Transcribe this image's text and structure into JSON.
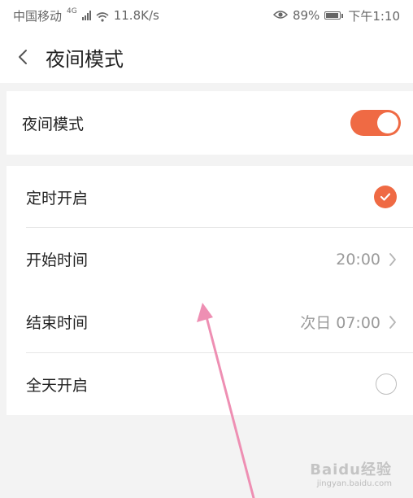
{
  "status_bar": {
    "carrier": "中国移动",
    "network_badge": "4G",
    "speed": "11.8K/s",
    "battery": "89%",
    "time": "下午1:10"
  },
  "header": {
    "title": "夜间模式"
  },
  "night_mode": {
    "label": "夜间模式",
    "enabled": true
  },
  "schedule": {
    "timed_on_label": "定时开启",
    "timed_on_checked": true,
    "start_label": "开始时间",
    "start_value": "20:00",
    "end_label": "结束时间",
    "end_value": "次日 07:00",
    "all_day_label": "全天开启",
    "all_day_checked": false
  },
  "watermark": {
    "text": "Baidu经验",
    "sub": "jingyan.baidu.com"
  },
  "colors": {
    "accent": "#ef6a44",
    "annotation_arrow": "#ee8fb3"
  }
}
